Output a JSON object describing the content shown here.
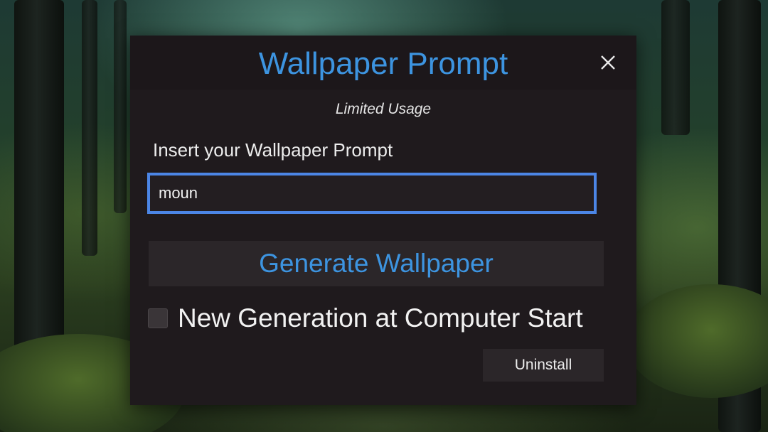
{
  "dialog": {
    "title": "Wallpaper Prompt",
    "subtitle": "Limited Usage",
    "close_icon": "close-icon",
    "prompt_label": "Insert your Wallpaper Prompt",
    "prompt_value": "moun",
    "generate_label": "Generate Wallpaper",
    "startup_checkbox_label": "New Generation at Computer Start",
    "startup_checkbox_checked": false,
    "uninstall_label": "Uninstall"
  },
  "colors": {
    "accent": "#3d94e0",
    "input_border": "#4c86e6",
    "dialog_background": "#1f1a1d"
  }
}
